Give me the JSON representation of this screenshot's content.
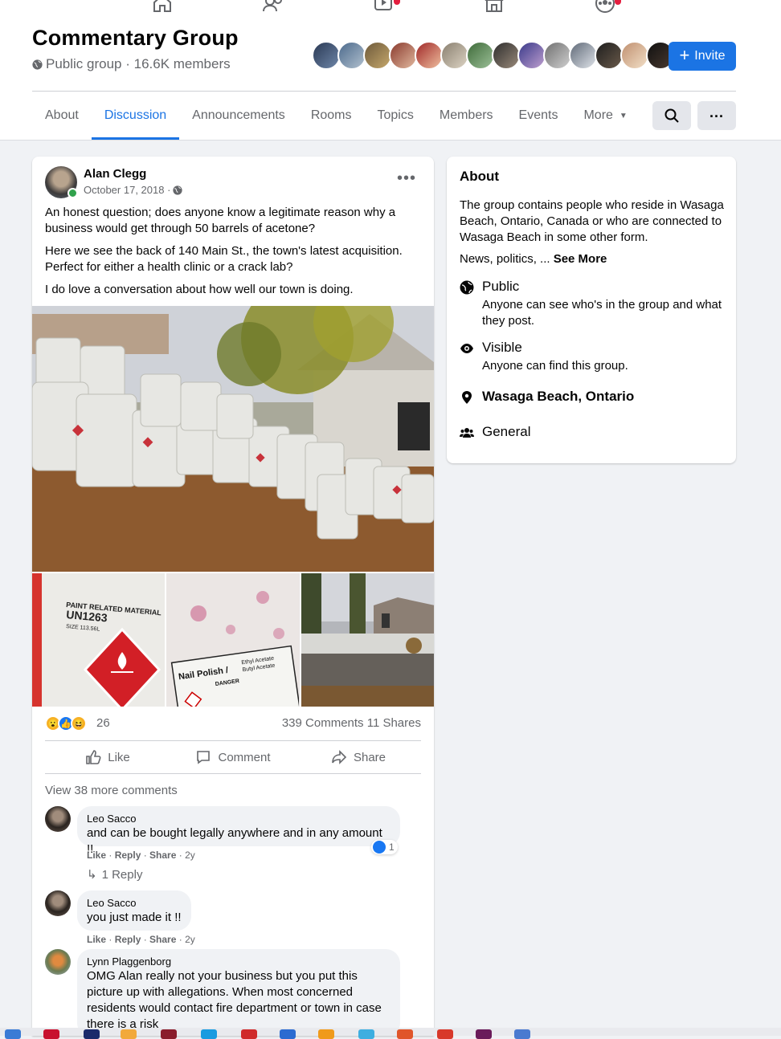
{
  "top_nav": {
    "icons": [
      "home-icon",
      "friends-icon",
      "watch-icon",
      "marketplace-icon",
      "groups-icon"
    ]
  },
  "group": {
    "title": "Commentary Group",
    "privacy_text": "Public group · 16.6K members",
    "invite_label": "Invite"
  },
  "tabs": [
    {
      "label": "About"
    },
    {
      "label": "Discussion"
    },
    {
      "label": "Announcements"
    },
    {
      "label": "Rooms"
    },
    {
      "label": "Topics"
    },
    {
      "label": "Members"
    },
    {
      "label": "Events"
    },
    {
      "label": "More"
    }
  ],
  "post": {
    "author": "Alan Clegg",
    "date": "October 17, 2018 ·",
    "paragraphs": [
      "An honest question; does anyone know a legitimate reason why a business would get through 50 barrels of acetone?",
      "Here we see the back of 140 Main St., the town's latest acquisition. Perfect for either a health clinic or a crack lab?",
      "I do love a conversation about how well our town is doing."
    ],
    "reaction_count": "26",
    "comment_share_counts": "339 Comments  11 Shares",
    "actions": {
      "like": "Like",
      "comment": "Comment",
      "share": "Share"
    },
    "view_more": "View 38 more comments",
    "comments": [
      {
        "name": "Leo Sacco",
        "text": "and can be bought legally anywhere and in any amount !!",
        "meta": {
          "like": "Like",
          "reply": "Reply",
          "share": "Share",
          "time": "2y"
        },
        "like_badge": "1",
        "replies": "1 Reply"
      },
      {
        "name": "Leo Sacco",
        "text": "you just made it !!",
        "meta": {
          "like": "Like",
          "reply": "Reply",
          "share": "Share",
          "time": "2y"
        }
      },
      {
        "name": "Lynn Plaggenborg",
        "text": "OMG Alan really not your business but you put this picture up with allegations. When most concerned residents would contact fire department or town in case there is a risk"
      }
    ],
    "photo_labels": {
      "thumb1_line1": "PAINT RELATED MATERIAL",
      "thumb1_line2": "UN1263",
      "thumb1_line3": "SIZE  113.56L",
      "thumb2_line1": "Nail Polish /",
      "thumb2_line2": "Ethyl Acetate",
      "thumb2_line3": "Butyl Acetate",
      "thumb2_line4": "DANGER"
    }
  },
  "about": {
    "heading": "About",
    "description": "The group contains people who reside in Wasaga Beach, Ontario, Canada or who are connected to Wasaga Beach in some other form.",
    "news_prefix": "News, politics, ...",
    "see_more": "See More",
    "rows": [
      {
        "icon": "globe-icon",
        "title": "Public",
        "sub": "Anyone can see who's in the group and what they post."
      },
      {
        "icon": "eye-icon",
        "title": "Visible",
        "sub": "Anyone can find this group."
      },
      {
        "icon": "location-pin-icon",
        "title": "Wasaga Beach, Ontario"
      },
      {
        "icon": "people-icon",
        "title": "General"
      }
    ]
  },
  "colors": {
    "accent": "#1b74e4",
    "text_secondary": "#65676b",
    "background": "#f0f2f5",
    "online": "#31a24c"
  }
}
